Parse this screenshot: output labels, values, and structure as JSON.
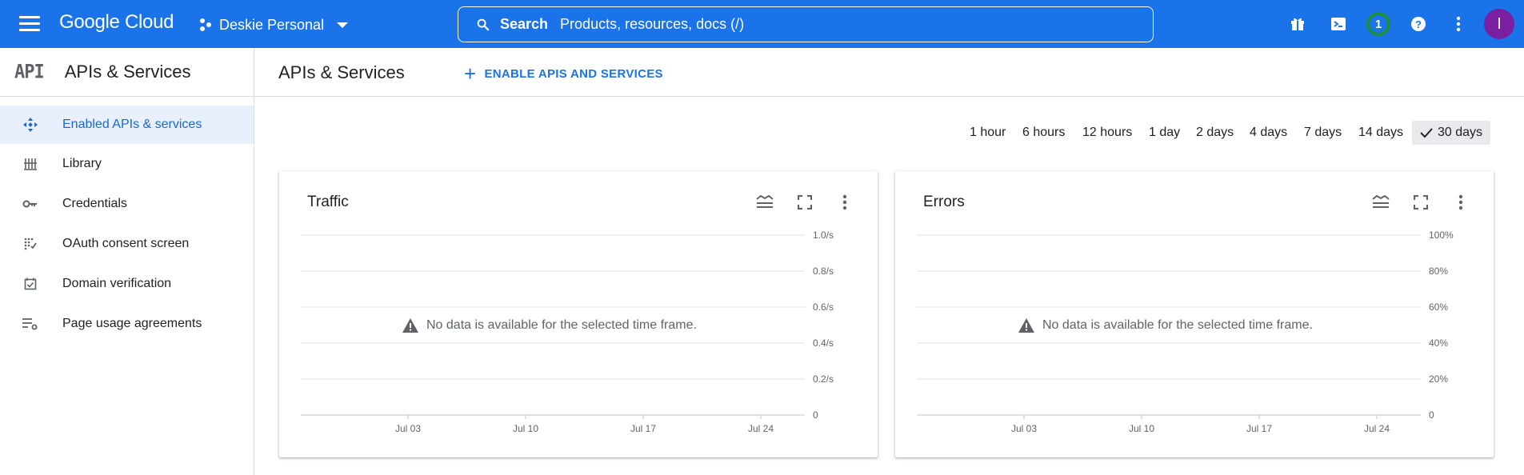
{
  "topbar": {
    "logo": "Google Cloud",
    "project": "Deskie Personal",
    "search_label": "Search",
    "search_placeholder": "Products, resources, docs (/)",
    "notification_count": "1",
    "avatar_initial": "I"
  },
  "sidebar": {
    "logo_text": "API",
    "title": "APIs & Services",
    "items": [
      {
        "label": "Enabled APIs & services",
        "icon": "enabled-apis-icon"
      },
      {
        "label": "Library",
        "icon": "library-icon"
      },
      {
        "label": "Credentials",
        "icon": "key-icon"
      },
      {
        "label": "OAuth consent screen",
        "icon": "oauth-icon"
      },
      {
        "label": "Domain verification",
        "icon": "checkbox-icon"
      },
      {
        "label": "Page usage agreements",
        "icon": "settings-list-icon"
      }
    ]
  },
  "main": {
    "title": "APIs & Services",
    "enable_button": "ENABLE APIS AND SERVICES",
    "time_ranges": [
      "1 hour",
      "6 hours",
      "12 hours",
      "1 day",
      "2 days",
      "4 days",
      "7 days",
      "14 days",
      "30 days"
    ],
    "selected_range": "30 days"
  },
  "cards": [
    {
      "title": "Traffic",
      "no_data": "No data is available for the selected time frame.",
      "y_ticks": [
        "1.0/s",
        "0.8/s",
        "0.6/s",
        "0.4/s",
        "0.2/s",
        "0"
      ],
      "x_ticks": [
        "Jul 03",
        "Jul 10",
        "Jul 17",
        "Jul 24"
      ]
    },
    {
      "title": "Errors",
      "no_data": "No data is available for the selected time frame.",
      "y_ticks": [
        "100%",
        "80%",
        "60%",
        "40%",
        "20%",
        "0"
      ],
      "x_ticks": [
        "Jul 03",
        "Jul 10",
        "Jul 17",
        "Jul 24"
      ]
    }
  ]
}
